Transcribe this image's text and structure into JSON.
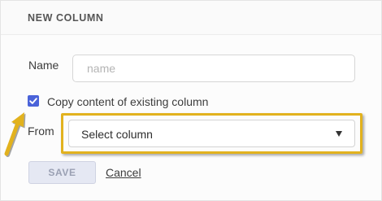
{
  "dialog": {
    "title": "NEW COLUMN"
  },
  "name_field": {
    "label": "Name",
    "placeholder": "name",
    "value": ""
  },
  "copy_option": {
    "label": "Copy content of existing column",
    "checked": true
  },
  "from_field": {
    "label": "From",
    "selected": "Select column"
  },
  "actions": {
    "save_label": "SAVE",
    "cancel_label": "Cancel"
  },
  "colors": {
    "accent": "#4a63d9",
    "highlight": "#e2b21e",
    "save_bg": "#e5e8f3"
  },
  "icons": {
    "checkbox": "check-icon",
    "select_caret": "caret-down-icon",
    "annotation": "annotation-arrow-icon"
  }
}
